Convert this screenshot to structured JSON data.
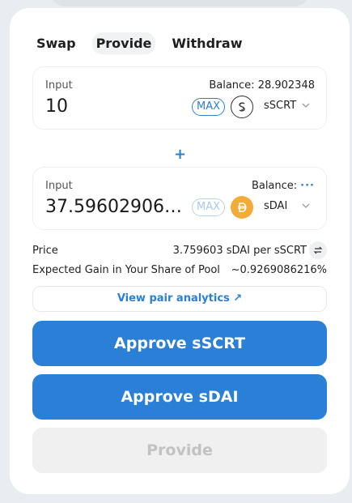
{
  "tabs": [
    {
      "label": "Swap"
    },
    {
      "label": "Provide"
    },
    {
      "label": "Withdraw"
    }
  ],
  "input_a": {
    "label": "Input",
    "balance": "Balance: 28.902348",
    "amount": "10",
    "max_label": "MAX",
    "token": "sSCRT"
  },
  "input_b": {
    "label": "Input",
    "balance_label": "Balance:",
    "balance_loading": "···",
    "amount": "37.596029063...",
    "max_label": "MAX",
    "token": "sDAI"
  },
  "plus": "+",
  "price": {
    "label": "Price",
    "value": "3.759603 sDAI per sSCRT"
  },
  "gain": {
    "label": "Expected Gain in Your Share of Pool",
    "value": "~0.9269086216%"
  },
  "analytics": {
    "label": "View pair analytics ↗"
  },
  "buttons": {
    "approve_a": "Approve sSCRT",
    "approve_b": "Approve sDAI",
    "provide": "Provide"
  },
  "colors": {
    "accent": "#2a80d6",
    "dai": "#f5ac37",
    "disabled_bg": "#f0f0f0"
  }
}
